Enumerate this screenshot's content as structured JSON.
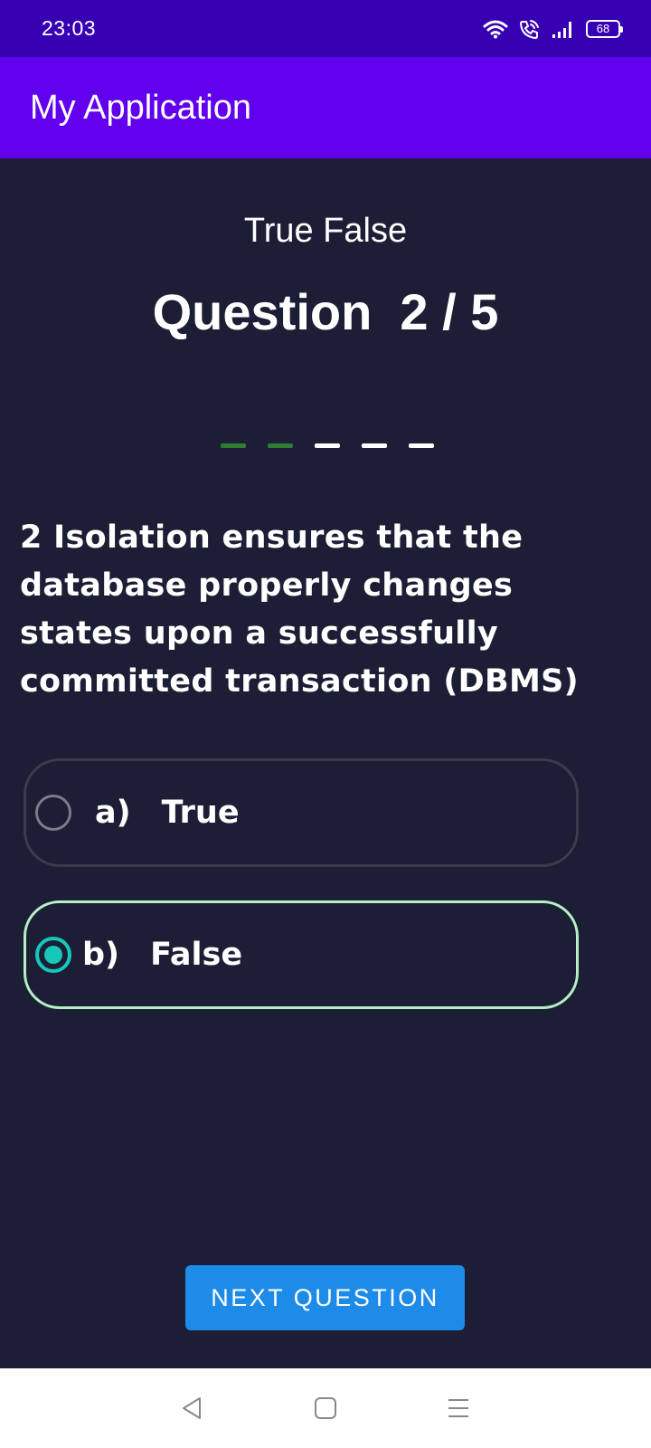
{
  "status_bar": {
    "time": "23:03",
    "battery": "68",
    "icons": [
      "wifi-icon",
      "wifi-calling-icon",
      "signal-icon",
      "battery-icon"
    ]
  },
  "app_bar": {
    "title": "My Application"
  },
  "quiz": {
    "type": "True False",
    "counter": "Question  2 / 5",
    "progress": {
      "answered": 2,
      "total": 5,
      "answered_color": "#2e7d32",
      "pending_color": "#ffffff"
    },
    "question": "2 Isolation ensures that the database properly changes states upon a successfully committed transaction (DBMS)",
    "options": [
      {
        "letter": "a)",
        "text": "True",
        "selected": false
      },
      {
        "letter": "b)",
        "text": "False",
        "selected": true
      }
    ],
    "next_button": "NEXT QUESTION"
  },
  "colors": {
    "status_bar": "#3700b3",
    "app_bar": "#6200ee",
    "background": "#1b1e35",
    "selected_border": "#b7efc5",
    "radio_accent": "#16c7ba",
    "button": "#1e8be8"
  },
  "nav_bar": {
    "icons": [
      "back-icon",
      "home-icon",
      "menu-icon"
    ]
  }
}
